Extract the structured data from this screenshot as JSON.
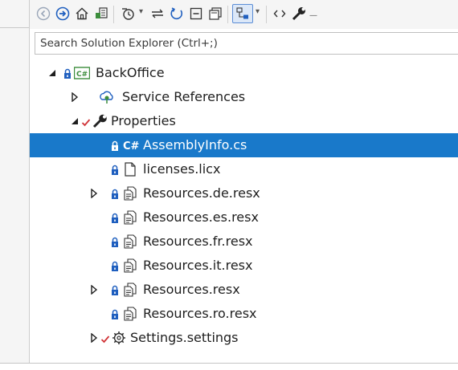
{
  "search": {
    "placeholder": "Search Solution Explorer (Ctrl+;)"
  },
  "colors": {
    "selection": "#1979ca",
    "lock": "#1f5fbf",
    "check": "#d13438",
    "csproj": "#3c8d3c"
  },
  "toolbar": {
    "icons": [
      "back-icon",
      "forward-icon",
      "home-icon",
      "switch-views-icon",
      "pending-changes-icon",
      "sync-icon",
      "refresh-icon",
      "collapse-all-icon",
      "show-all-files-icon",
      "filter-icon",
      "code-view-icon",
      "properties-icon"
    ]
  },
  "tree": {
    "project": {
      "label": "BackOffice"
    },
    "service_references": {
      "label": "Service References"
    },
    "properties": {
      "label": "Properties"
    },
    "files": [
      {
        "label": "AssemblyInfo.cs"
      },
      {
        "label": "licenses.licx"
      },
      {
        "label": "Resources.de.resx"
      },
      {
        "label": "Resources.es.resx"
      },
      {
        "label": "Resources.fr.resx"
      },
      {
        "label": "Resources.it.resx"
      },
      {
        "label": "Resources.resx"
      },
      {
        "label": "Resources.ro.resx"
      },
      {
        "label": "Settings.settings"
      }
    ]
  }
}
